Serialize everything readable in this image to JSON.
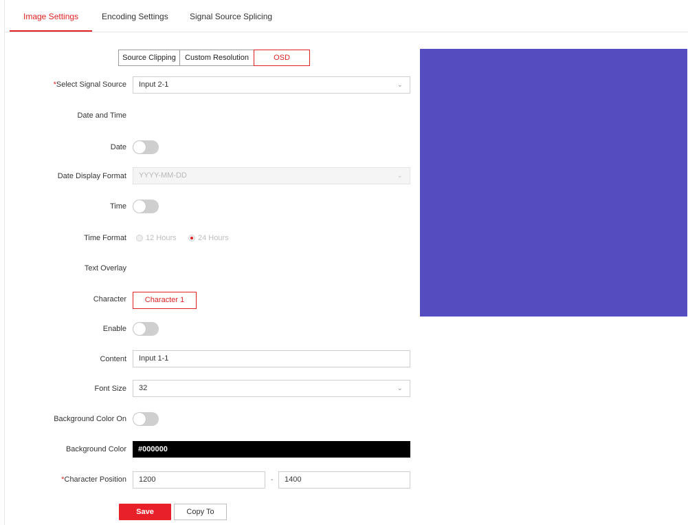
{
  "tabs": [
    "Image Settings",
    "Encoding Settings",
    "Signal Source Splicing"
  ],
  "active_tab": "Image Settings",
  "subtabs": [
    "Source Clipping",
    "Custom Resolution",
    "OSD"
  ],
  "active_subtab": "OSD",
  "form": {
    "select_signal_source": {
      "label": "Select Signal Source",
      "required": "*",
      "value": "Input 2-1"
    },
    "date_and_time_heading": "Date and Time",
    "date": {
      "label": "Date",
      "on": false
    },
    "date_display_format": {
      "label": "Date Display Format",
      "value": "YYYY-MM-DD",
      "disabled": true
    },
    "time": {
      "label": "Time",
      "on": false
    },
    "time_format": {
      "label": "Time Format",
      "options": [
        "12 Hours",
        "24 Hours"
      ],
      "selected": "24 Hours"
    },
    "text_overlay_heading": "Text Overlay",
    "character": {
      "label": "Character",
      "value": "Character 1"
    },
    "enable": {
      "label": "Enable",
      "on": false
    },
    "content": {
      "label": "Content",
      "value": "Input 1-1"
    },
    "font_size": {
      "label": "Font Size",
      "value": "32"
    },
    "background_color_on": {
      "label": "Background Color On",
      "on": false
    },
    "background_color": {
      "label": "Background Color",
      "value": "#000000"
    },
    "character_position": {
      "label": "Character Position",
      "required": "*",
      "x": "1200",
      "separator": "-",
      "y": "1400"
    }
  },
  "buttons": {
    "save": "Save",
    "copy_to": "Copy To"
  },
  "icons": {
    "dropdown": "chevron-down-icon"
  },
  "colors": {
    "accent": "#e02020",
    "preview": "#554cc0",
    "background_color_swatch": "#000000"
  }
}
